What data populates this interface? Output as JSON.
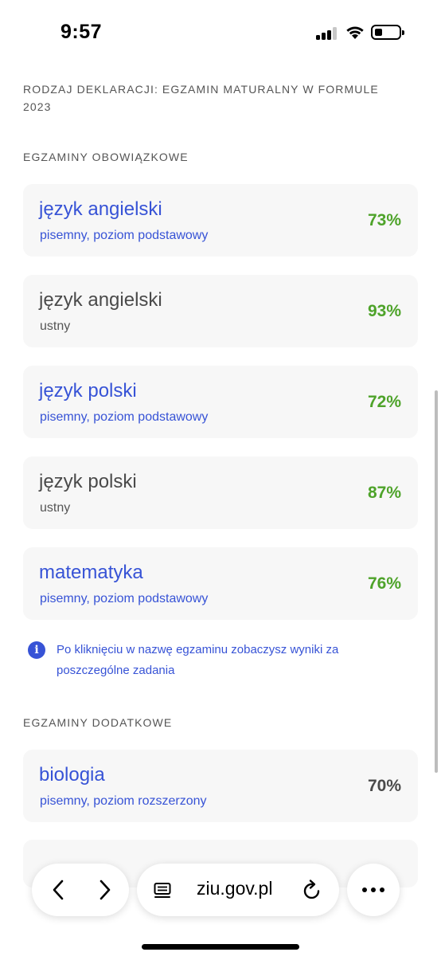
{
  "status_bar": {
    "time": "9:57"
  },
  "declaration_label": "RODZAJ DEKLARACJI: EGZAMIN MATURALNY W FORMULE 2023",
  "mandatory": {
    "heading": "EGZAMINY OBOWIĄZKOWE",
    "exams": [
      {
        "name": "język angielski",
        "type": "pisemny, poziom podstawowy",
        "score": "73%",
        "score_color": "#4ea32a",
        "clickable": true
      },
      {
        "name": "język angielski",
        "type": "ustny",
        "score": "93%",
        "score_color": "#4ea32a",
        "clickable": false
      },
      {
        "name": "język polski",
        "type": "pisemny, poziom podstawowy",
        "score": "72%",
        "score_color": "#4ea32a",
        "clickable": true
      },
      {
        "name": "język polski",
        "type": "ustny",
        "score": "87%",
        "score_color": "#4ea32a",
        "clickable": false
      },
      {
        "name": "matematyka",
        "type": "pisemny, poziom podstawowy",
        "score": "76%",
        "score_color": "#4ea32a",
        "clickable": true
      }
    ]
  },
  "info_note": {
    "icon": "info-icon",
    "text": "Po kliknięciu w nazwę egzaminu zobaczysz wyniki za poszczególne zadania"
  },
  "additional": {
    "heading": "EGZAMINY DODATKOWE",
    "exams": [
      {
        "name": "biologia",
        "type": "pisemny, poziom rozszerzony",
        "score": "70%",
        "score_color": "#4a4a4a",
        "clickable": true
      }
    ]
  },
  "browser": {
    "url": "ziu.gov.pl",
    "back_icon": "chevron-left-icon",
    "forward_icon": "chevron-right-icon",
    "reader_icon": "reader-icon",
    "reload_icon": "reload-icon",
    "more_icon": "more-icon"
  },
  "colors": {
    "link": "#3753d6",
    "score_green": "#4ea32a",
    "card_bg": "#f7f7f7"
  }
}
